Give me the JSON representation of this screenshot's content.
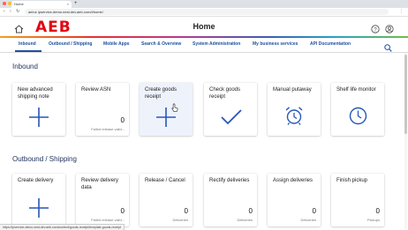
{
  "browser": {
    "tab_title": "Home",
    "tab_close": "×",
    "new_tab": "+",
    "nav_buttons": "‹ › ↻",
    "url": "aeb ▸ ipservice-demo.nest.dev.aeb.com/#home/",
    "menu": "⋮",
    "window_dot_colors": [
      "#ff5f57",
      "#febc2e",
      "#28c840"
    ]
  },
  "header": {
    "logo": "AEB",
    "title": "Home",
    "icons": [
      "home-icon",
      "help-icon",
      "user-icon"
    ]
  },
  "nav": {
    "items": [
      {
        "label": "Inbound"
      },
      {
        "label": "Outbound / Shipping"
      },
      {
        "label": "Mobile Apps"
      },
      {
        "label": "Search & Overview"
      },
      {
        "label": "System Administration"
      },
      {
        "label": "My business services"
      },
      {
        "label": "API Documentation"
      }
    ],
    "active": "Inbound"
  },
  "sections": [
    {
      "title": "Inbound",
      "cards": [
        {
          "title": "New advanced shipping note",
          "icon": "plus-icon"
        },
        {
          "title": "Review ASN",
          "count": "0",
          "sub": "Failed release valid..."
        },
        {
          "title": "Create goods receipt",
          "icon": "plus-icon"
        },
        {
          "title": "Check goods receipt",
          "icon": "checkmark-icon"
        },
        {
          "title": "Manual putaway",
          "icon": "alarm-clock-icon"
        },
        {
          "title": "Shelf life monitor",
          "icon": "clock-icon"
        }
      ]
    },
    {
      "title": "Outbound / Shipping",
      "cards": [
        {
          "title": "Create delivery",
          "icon": "plus-icon"
        },
        {
          "title": "Review delivery data",
          "count": "0",
          "sub": "Failed release valid..."
        },
        {
          "title": "Release / Cancel",
          "count": "0",
          "sub": "Deliveries"
        },
        {
          "title": "Rectify deliveries",
          "count": "0",
          "sub": "Deliveries"
        },
        {
          "title": "Assign deliveries",
          "count": "0",
          "sub": "Deliveries"
        },
        {
          "title": "Finish pickup",
          "count": "0",
          "sub": "Pickups"
        }
      ]
    }
  ],
  "status_url": "https://ipservice-demo.nest.dev.aeb.com/content/goods-receipt/template-goods-receipt",
  "colors": {
    "accent": "#1f4fa0",
    "logo_red": "#e30613",
    "heading": "#1c2f5c"
  }
}
